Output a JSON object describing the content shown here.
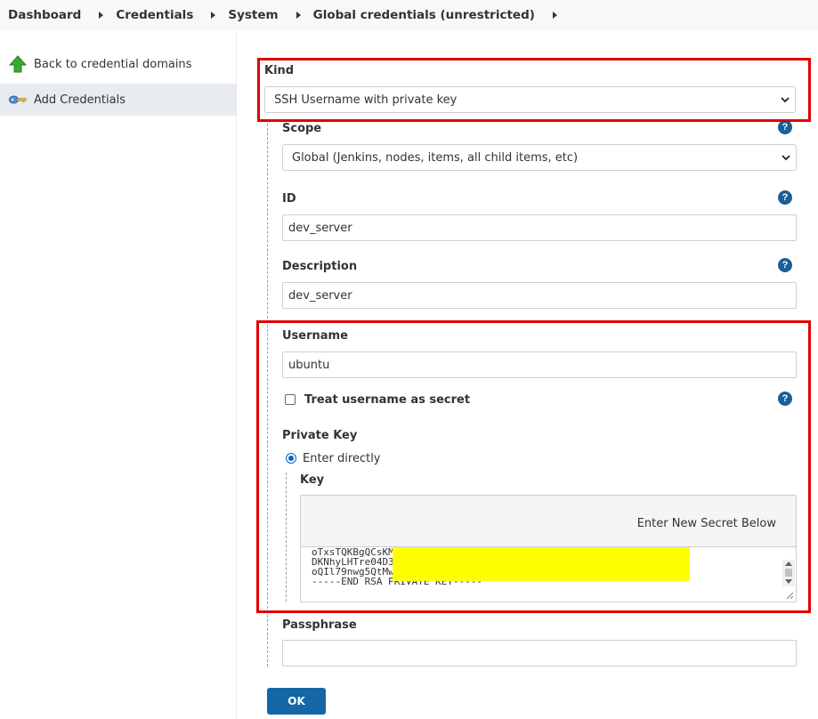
{
  "breadcrumb": {
    "items": [
      "Dashboard",
      "Credentials",
      "System",
      "Global credentials (unrestricted)"
    ]
  },
  "sidebar": {
    "items": [
      {
        "label": "Back to credential domains",
        "icon": "up-arrow-icon"
      },
      {
        "label": "Add Credentials",
        "icon": "key-icon"
      }
    ]
  },
  "form": {
    "kind": {
      "label": "Kind",
      "value": "SSH Username with private key"
    },
    "scope": {
      "label": "Scope",
      "value": "Global (Jenkins, nodes, items, all child items, etc)"
    },
    "id": {
      "label": "ID",
      "value": "dev_server"
    },
    "description": {
      "label": "Description",
      "value": "dev_server"
    },
    "username": {
      "label": "Username",
      "value": "ubuntu"
    },
    "treat_secret": {
      "label": "Treat username as secret",
      "checked": false
    },
    "private_key": {
      "label": "Private Key",
      "enter_directly": "Enter directly",
      "key_label": "Key",
      "secret_caption": "Enter New Secret Below",
      "key_lines": [
        "oTxsTQKBgQCsKM",
        "DKNhyLHTre04D3",
        "oQIl79nwg5QtMw",
        "-----END RSA PRIVATE KEY-----"
      ]
    },
    "passphrase": {
      "label": "Passphrase",
      "value": ""
    },
    "ok_button": "OK",
    "help_glyph": "?"
  },
  "colors": {
    "highlight_border": "#e00000",
    "primary_button": "#1466a6",
    "redaction": "#ffff00"
  }
}
